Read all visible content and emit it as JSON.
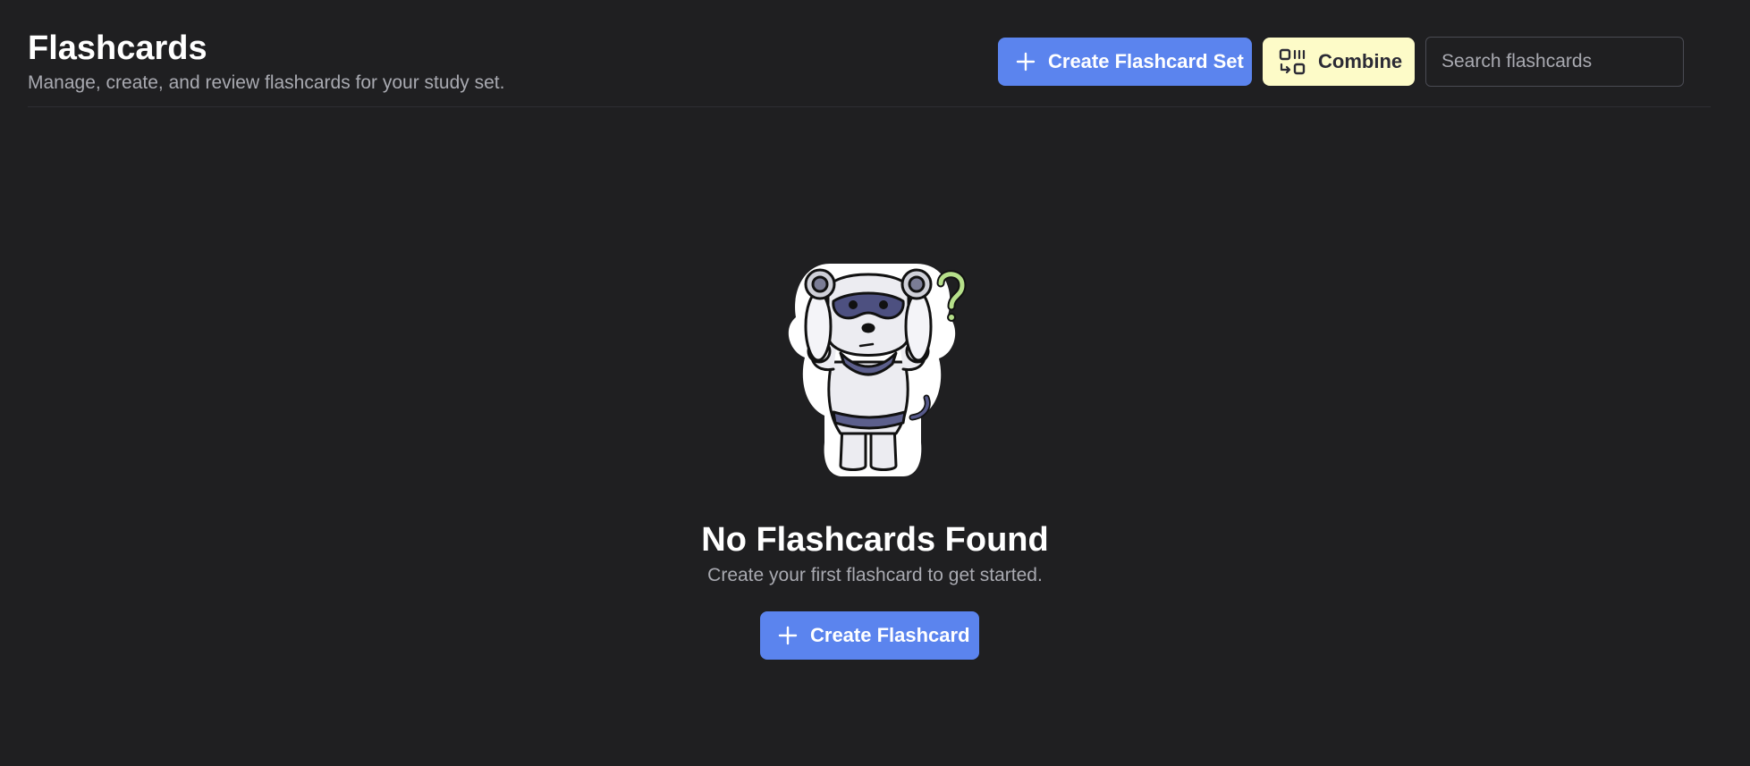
{
  "header": {
    "title": "Flashcards",
    "subtitle": "Manage, create, and review flashcards for your study set."
  },
  "toolbar": {
    "create_set_label": "Create Flashcard Set",
    "combine_label": "Combine",
    "search_placeholder": "Search flashcards",
    "search_value": ""
  },
  "empty_state": {
    "title": "No Flashcards Found",
    "text": "Create your first flashcard to get started.",
    "button_label": "Create Flashcard"
  },
  "icons": {
    "create_set": "plus-icon",
    "combine": "combine-icon",
    "create_card": "plus-icon",
    "illustration": "confused-dog-mascot"
  },
  "colors": {
    "background": "#1f1f21",
    "primary": "#5b84ee",
    "combine_bg": "#fdfbc8",
    "muted_text": "#a9aab1"
  }
}
